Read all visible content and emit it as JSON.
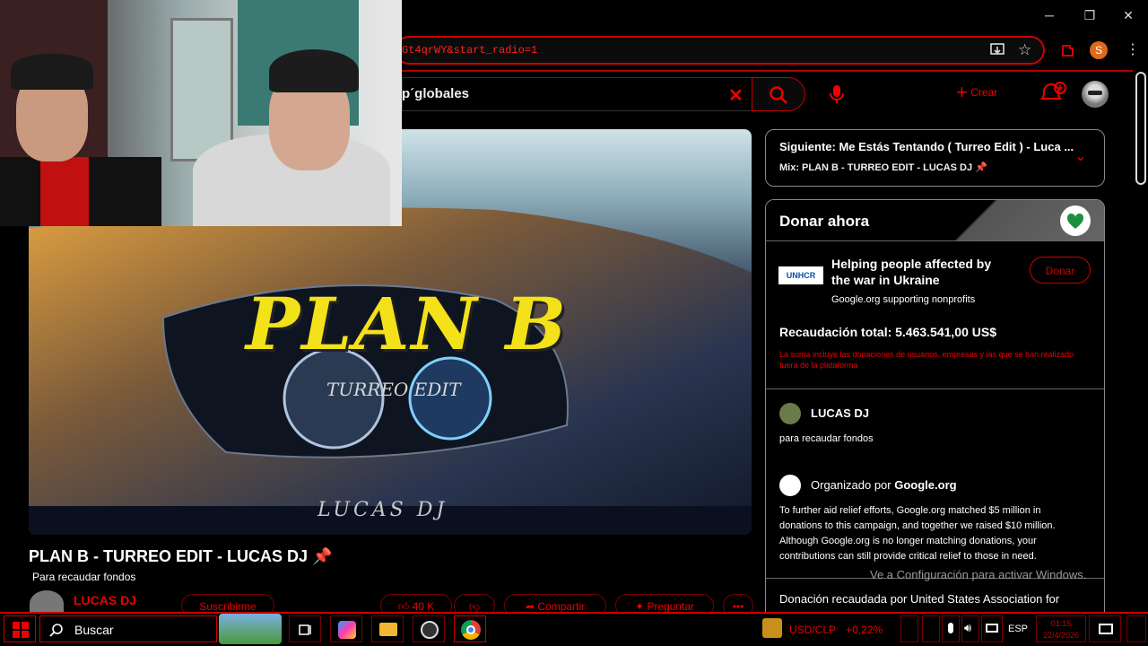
{
  "browser": {
    "url": "Gt4qrWY&start_radio=1",
    "profile_initial": "S",
    "controls": {
      "minimize": "─",
      "maximize": "❐",
      "close": "✕"
    }
  },
  "youtube": {
    "search_query": "p´globales",
    "create_label": "Crear",
    "video": {
      "thumbnail_title": "PLAN B",
      "thumbnail_subtitle": "TURREO EDIT",
      "thumbnail_credit": "LUCAS DJ",
      "title": "PLAN B - TURREO EDIT - LUCAS DJ 📌",
      "description": "Para recaudar fondos",
      "channel": "LUCAS DJ"
    },
    "actions": {
      "subscribe": "Suscribirme",
      "likes": "40 K",
      "share": "Compartir",
      "ask": "Preguntar",
      "more": "•••"
    },
    "up_next": {
      "title": "Siguiente: Me Estás Tentando ( Turreo Edit ) - Luca ...",
      "mix": "Mix: PLAN B - TURREO EDIT - LUCAS DJ 📌"
    },
    "donate": {
      "header": "Donar ahora",
      "org_logo": "UNHCR",
      "campaign_title": "Helping people affected by the war in Ukraine",
      "campaign_sub": "Google.org supporting nonprofits",
      "donate_button": "Donar",
      "total": "Recaudación total: 5.463.541,00 US$",
      "total_note": "La suma incluye las donaciones de usuarios, empresas y las que se han realizado fuera de la plataforma",
      "creator_name": "LUCAS DJ",
      "creator_sub": "para recaudar fondos",
      "organized_prefix": "Organizado por ",
      "organized_by": "Google.org",
      "org_description": "To further aid relief efforts, Google.org matched $5 million in donations to this campaign, and together we raised $10 million. Although Google.org is no longer matching donations, your contributions can still provide critical relief to those in need.",
      "raised_by": "Donación recaudada por United States Association for"
    }
  },
  "windows_watermark": "Ve a Configuración para activar Windows.",
  "taskbar": {
    "search_label": "Buscar",
    "currency": "USD/CLP",
    "currency_change": "+0,22%",
    "language": "ESP",
    "time": "01:15",
    "date": "22/4/2026"
  },
  "colors": {
    "accent": "#e00000",
    "background": "#000000"
  }
}
